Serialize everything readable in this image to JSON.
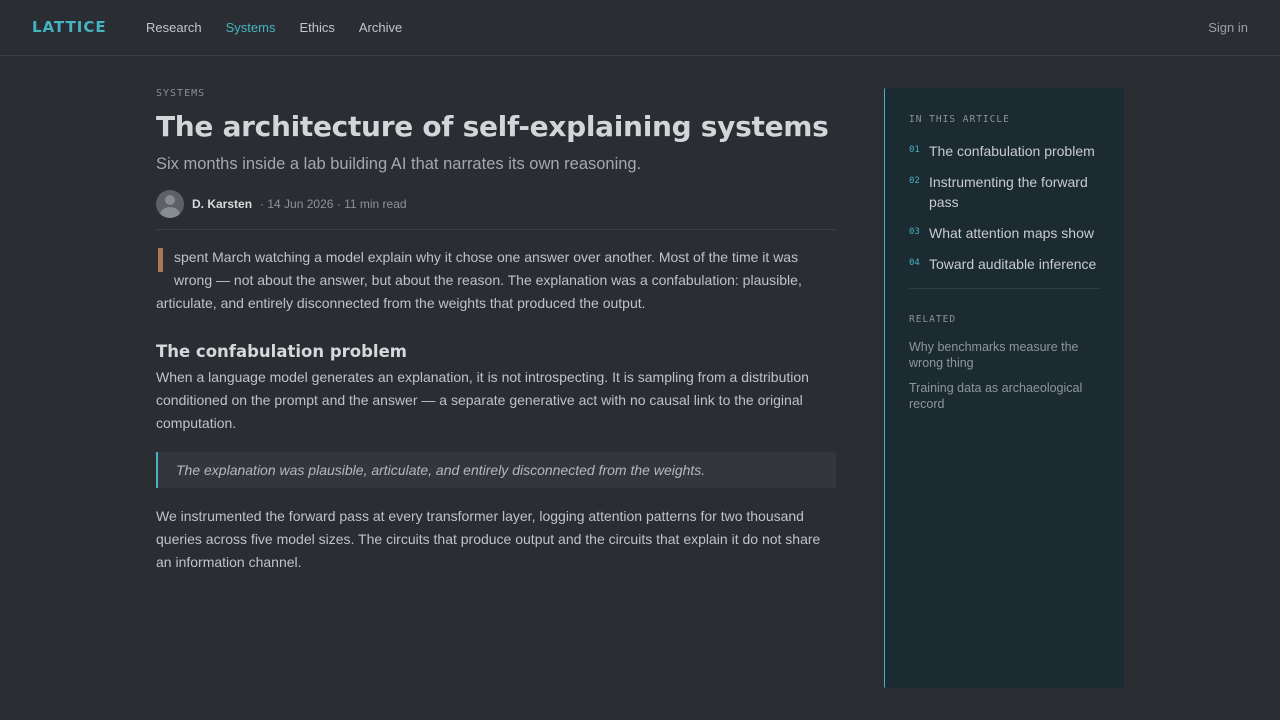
{
  "header": {
    "logo": "LATTICE",
    "nav": [
      "Research",
      "Systems",
      "Ethics",
      "Archive"
    ],
    "active_nav": "Systems",
    "sign_in": "Sign in"
  },
  "article": {
    "kicker": "SYSTEMS",
    "title": "The architecture of self-explaining systems",
    "subtitle": "Six months inside a lab building AI that narrates its own reasoning.",
    "author": "D. Karsten",
    "meta": "· 14 Jun 2026 · 11 min read",
    "lead": "spent March watching a model explain why it chose one answer over another. Most of the time it was wrong — not about the answer, but about the reason. The explanation was a confabulation: plausible, articulate, and entirely disconnected from the weights that produced the output.",
    "section_heading": "The confabulation problem",
    "section_para": "When a language model generates an explanation, it is not introspecting. It is sampling from a distribution conditioned on the prompt and the answer — a separate generative act with no causal link to the original computation.",
    "pullquote": "The explanation was plausible, articulate, and entirely disconnected from the weights.",
    "final_para": "We instrumented the forward pass at every transformer layer, logging attention patterns for two thousand queries across five model sizes. The circuits that produce output and the circuits that explain it do not share an information channel."
  },
  "sidebar": {
    "toc_label": "IN THIS ARTICLE",
    "toc": [
      {
        "num": "01",
        "text": "The confabulation problem"
      },
      {
        "num": "02",
        "text": "Instrumenting the forward pass"
      },
      {
        "num": "03",
        "text": "What attention maps show"
      },
      {
        "num": "04",
        "text": "Toward auditable inference"
      }
    ],
    "related_label": "RELATED",
    "related": [
      "Why benchmarks measure the wrong thing",
      "Training data as archaeological record"
    ]
  },
  "colors": {
    "accent": "#45b4c2",
    "background": "#2a2d31",
    "sidebar": "#1c2a31",
    "dropcap": "#a87a5a"
  }
}
